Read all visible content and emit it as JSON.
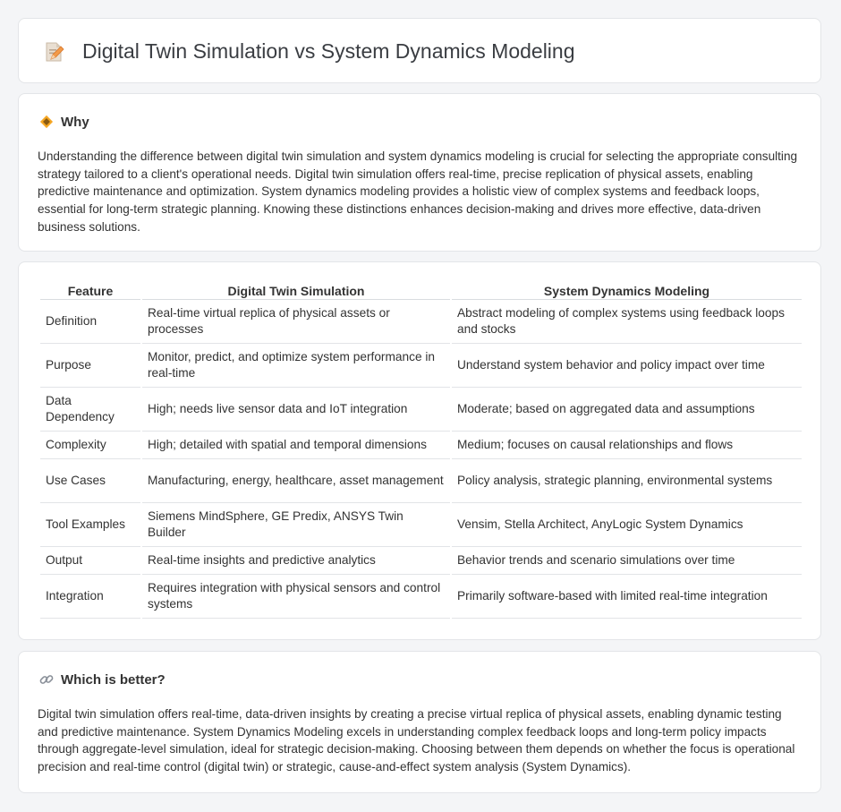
{
  "header": {
    "title": "Digital Twin Simulation vs System Dynamics Modeling",
    "icon": "document-edit-icon"
  },
  "why": {
    "title": "Why",
    "icon": "diamond-sign-icon",
    "text": "Understanding the difference between digital twin simulation and system dynamics modeling is crucial for selecting the appropriate consulting strategy tailored to a client's operational needs. Digital twin simulation offers real-time, precise replication of physical assets, enabling predictive maintenance and optimization. System dynamics modeling provides a holistic view of complex systems and feedback loops, essential for long-term strategic planning. Knowing these distinctions enhances decision-making and drives more effective, data-driven business solutions."
  },
  "table": {
    "headers": [
      "Feature",
      "Digital Twin Simulation",
      "System Dynamics Modeling"
    ],
    "rows": [
      [
        "Definition",
        "Real-time virtual replica of physical assets or processes",
        "Abstract modeling of complex systems using feedback loops and stocks"
      ],
      [
        "Purpose",
        "Monitor, predict, and optimize system performance in real-time",
        "Understand system behavior and policy impact over time"
      ],
      [
        "Data Dependency",
        "High; needs live sensor data and IoT integration",
        "Moderate; based on aggregated data and assumptions"
      ],
      [
        "Complexity",
        "High; detailed with spatial and temporal dimensions",
        "Medium; focuses on causal relationships and flows"
      ],
      [
        "Use Cases",
        "Manufacturing, energy, healthcare, asset management",
        "Policy analysis, strategic planning, environmental systems"
      ],
      [
        "Tool Examples",
        "Siemens MindSphere, GE Predix, ANSYS Twin Builder",
        "Vensim, Stella Architect, AnyLogic System Dynamics"
      ],
      [
        "Output",
        "Real-time insights and predictive analytics",
        "Behavior trends and scenario simulations over time"
      ],
      [
        "Integration",
        "Requires integration with physical sensors and control systems",
        "Primarily software-based with limited real-time integration"
      ]
    ]
  },
  "better": {
    "title": "Which is better?",
    "icon": "link-icon",
    "text": "Digital twin simulation offers real-time, data-driven insights by creating a precise virtual replica of physical assets, enabling dynamic testing and predictive maintenance. System Dynamics Modeling excels in understanding complex feedback loops and long-term policy impacts through aggregate-level simulation, ideal for strategic decision-making. Choosing between them depends on whether the focus is operational precision and real-time control (digital twin) or strategic, cause-and-effect system analysis (System Dynamics)."
  }
}
